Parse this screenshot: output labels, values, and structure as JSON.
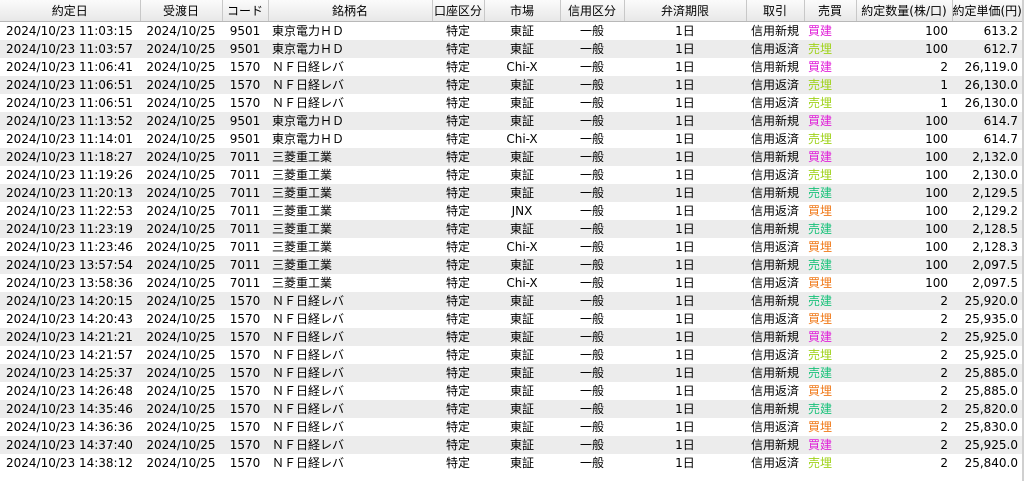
{
  "columns": [
    "約定日",
    "受渡日",
    "コード",
    "銘柄名",
    "口座区分",
    "市場",
    "信用区分",
    "弁済期限",
    "取引",
    "売買",
    "約定数量(株/口)",
    "約定単価(円)"
  ],
  "colors": {
    "買建": "#e01fd8",
    "売建": "#19c27a",
    "買埋": "#f07a1a",
    "売埋": "#9fd21a"
  },
  "rows": [
    [
      "2024/10/23 11:03:15",
      "2024/10/25",
      "9501",
      "東京電力ＨＤ",
      "特定",
      "東証",
      "一般",
      "1日",
      "信用新規",
      "買建",
      "100",
      "613.2"
    ],
    [
      "2024/10/23 11:03:57",
      "2024/10/25",
      "9501",
      "東京電力ＨＤ",
      "特定",
      "東証",
      "一般",
      "1日",
      "信用返済",
      "売埋",
      "100",
      "612.7"
    ],
    [
      "2024/10/23 11:06:41",
      "2024/10/25",
      "1570",
      "ＮＦ日経レバ",
      "特定",
      "Chi-X",
      "一般",
      "1日",
      "信用新規",
      "買建",
      "2",
      "26,119.0"
    ],
    [
      "2024/10/23 11:06:51",
      "2024/10/25",
      "1570",
      "ＮＦ日経レバ",
      "特定",
      "東証",
      "一般",
      "1日",
      "信用返済",
      "売埋",
      "1",
      "26,130.0"
    ],
    [
      "2024/10/23 11:06:51",
      "2024/10/25",
      "1570",
      "ＮＦ日経レバ",
      "特定",
      "東証",
      "一般",
      "1日",
      "信用返済",
      "売埋",
      "1",
      "26,130.0"
    ],
    [
      "2024/10/23 11:13:52",
      "2024/10/25",
      "9501",
      "東京電力ＨＤ",
      "特定",
      "東証",
      "一般",
      "1日",
      "信用新規",
      "買建",
      "100",
      "614.7"
    ],
    [
      "2024/10/23 11:14:01",
      "2024/10/25",
      "9501",
      "東京電力ＨＤ",
      "特定",
      "Chi-X",
      "一般",
      "1日",
      "信用返済",
      "売埋",
      "100",
      "614.7"
    ],
    [
      "2024/10/23 11:18:27",
      "2024/10/25",
      "7011",
      "三菱重工業",
      "特定",
      "東証",
      "一般",
      "1日",
      "信用新規",
      "買建",
      "100",
      "2,132.0"
    ],
    [
      "2024/10/23 11:19:26",
      "2024/10/25",
      "7011",
      "三菱重工業",
      "特定",
      "東証",
      "一般",
      "1日",
      "信用返済",
      "売埋",
      "100",
      "2,130.0"
    ],
    [
      "2024/10/23 11:20:13",
      "2024/10/25",
      "7011",
      "三菱重工業",
      "特定",
      "東証",
      "一般",
      "1日",
      "信用新規",
      "売建",
      "100",
      "2,129.5"
    ],
    [
      "2024/10/23 11:22:53",
      "2024/10/25",
      "7011",
      "三菱重工業",
      "特定",
      "JNX",
      "一般",
      "1日",
      "信用返済",
      "買埋",
      "100",
      "2,129.2"
    ],
    [
      "2024/10/23 11:23:19",
      "2024/10/25",
      "7011",
      "三菱重工業",
      "特定",
      "東証",
      "一般",
      "1日",
      "信用新規",
      "売建",
      "100",
      "2,128.5"
    ],
    [
      "2024/10/23 11:23:46",
      "2024/10/25",
      "7011",
      "三菱重工業",
      "特定",
      "Chi-X",
      "一般",
      "1日",
      "信用返済",
      "買埋",
      "100",
      "2,128.3"
    ],
    [
      "2024/10/23 13:57:54",
      "2024/10/25",
      "7011",
      "三菱重工業",
      "特定",
      "東証",
      "一般",
      "1日",
      "信用新規",
      "売建",
      "100",
      "2,097.5"
    ],
    [
      "2024/10/23 13:58:36",
      "2024/10/25",
      "7011",
      "三菱重工業",
      "特定",
      "Chi-X",
      "一般",
      "1日",
      "信用返済",
      "買埋",
      "100",
      "2,097.5"
    ],
    [
      "2024/10/23 14:20:15",
      "2024/10/25",
      "1570",
      "ＮＦ日経レバ",
      "特定",
      "東証",
      "一般",
      "1日",
      "信用新規",
      "売建",
      "2",
      "25,920.0"
    ],
    [
      "2024/10/23 14:20:43",
      "2024/10/25",
      "1570",
      "ＮＦ日経レバ",
      "特定",
      "東証",
      "一般",
      "1日",
      "信用返済",
      "買埋",
      "2",
      "25,935.0"
    ],
    [
      "2024/10/23 14:21:21",
      "2024/10/25",
      "1570",
      "ＮＦ日経レバ",
      "特定",
      "東証",
      "一般",
      "1日",
      "信用新規",
      "買建",
      "2",
      "25,925.0"
    ],
    [
      "2024/10/23 14:21:57",
      "2024/10/25",
      "1570",
      "ＮＦ日経レバ",
      "特定",
      "東証",
      "一般",
      "1日",
      "信用返済",
      "売埋",
      "2",
      "25,925.0"
    ],
    [
      "2024/10/23 14:25:37",
      "2024/10/25",
      "1570",
      "ＮＦ日経レバ",
      "特定",
      "東証",
      "一般",
      "1日",
      "信用新規",
      "売建",
      "2",
      "25,885.0"
    ],
    [
      "2024/10/23 14:26:48",
      "2024/10/25",
      "1570",
      "ＮＦ日経レバ",
      "特定",
      "東証",
      "一般",
      "1日",
      "信用返済",
      "買埋",
      "2",
      "25,885.0"
    ],
    [
      "2024/10/23 14:35:46",
      "2024/10/25",
      "1570",
      "ＮＦ日経レバ",
      "特定",
      "東証",
      "一般",
      "1日",
      "信用新規",
      "売建",
      "2",
      "25,820.0"
    ],
    [
      "2024/10/23 14:36:36",
      "2024/10/25",
      "1570",
      "ＮＦ日経レバ",
      "特定",
      "東証",
      "一般",
      "1日",
      "信用返済",
      "買埋",
      "2",
      "25,830.0"
    ],
    [
      "2024/10/23 14:37:40",
      "2024/10/25",
      "1570",
      "ＮＦ日経レバ",
      "特定",
      "東証",
      "一般",
      "1日",
      "信用新規",
      "買建",
      "2",
      "25,925.0"
    ],
    [
      "2024/10/23 14:38:12",
      "2024/10/25",
      "1570",
      "ＮＦ日経レバ",
      "特定",
      "東証",
      "一般",
      "1日",
      "信用返済",
      "売埋",
      "2",
      "25,840.0"
    ]
  ]
}
